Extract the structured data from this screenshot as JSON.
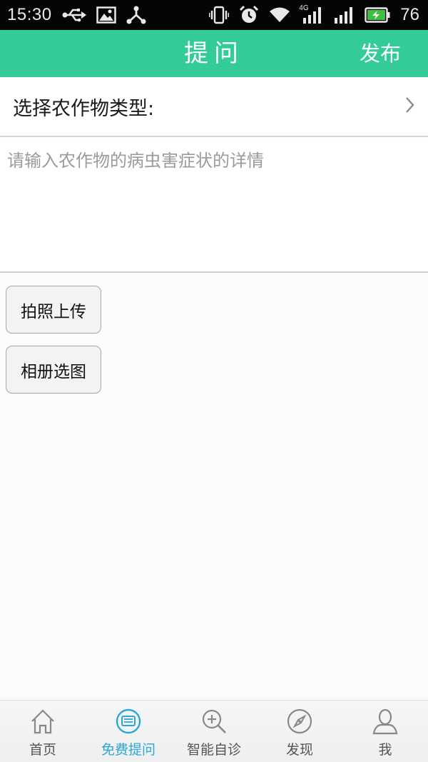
{
  "status_bar": {
    "time": "15:30",
    "battery_percent": "76",
    "network_label": "4G",
    "icons_left": [
      "usb-icon",
      "image-icon",
      "share-icon"
    ],
    "icons_right": [
      "vibrate-icon",
      "alarm-icon",
      "wifi-icon",
      "signal-4g-icon",
      "signal-icon",
      "battery-charging-icon"
    ]
  },
  "header": {
    "title": "提问",
    "action_label": "发布",
    "background_color": "#33cc99"
  },
  "form": {
    "crop_type_label": "选择农作物类型:",
    "description_placeholder": "请输入农作物的病虫害症状的详情",
    "description_value": ""
  },
  "buttons": {
    "take_photo": "拍照上传",
    "choose_album": "相册选图"
  },
  "tabbar": {
    "active_color": "#29a7d8",
    "items": [
      {
        "label": "首页",
        "icon": "home-icon",
        "active": false
      },
      {
        "label": "免费提问",
        "icon": "chat-bubble-icon",
        "active": true
      },
      {
        "label": "智能自诊",
        "icon": "magnifier-plus-icon",
        "active": false
      },
      {
        "label": "发现",
        "icon": "compass-icon",
        "active": false
      },
      {
        "label": "我",
        "icon": "user-icon",
        "active": false
      }
    ]
  }
}
